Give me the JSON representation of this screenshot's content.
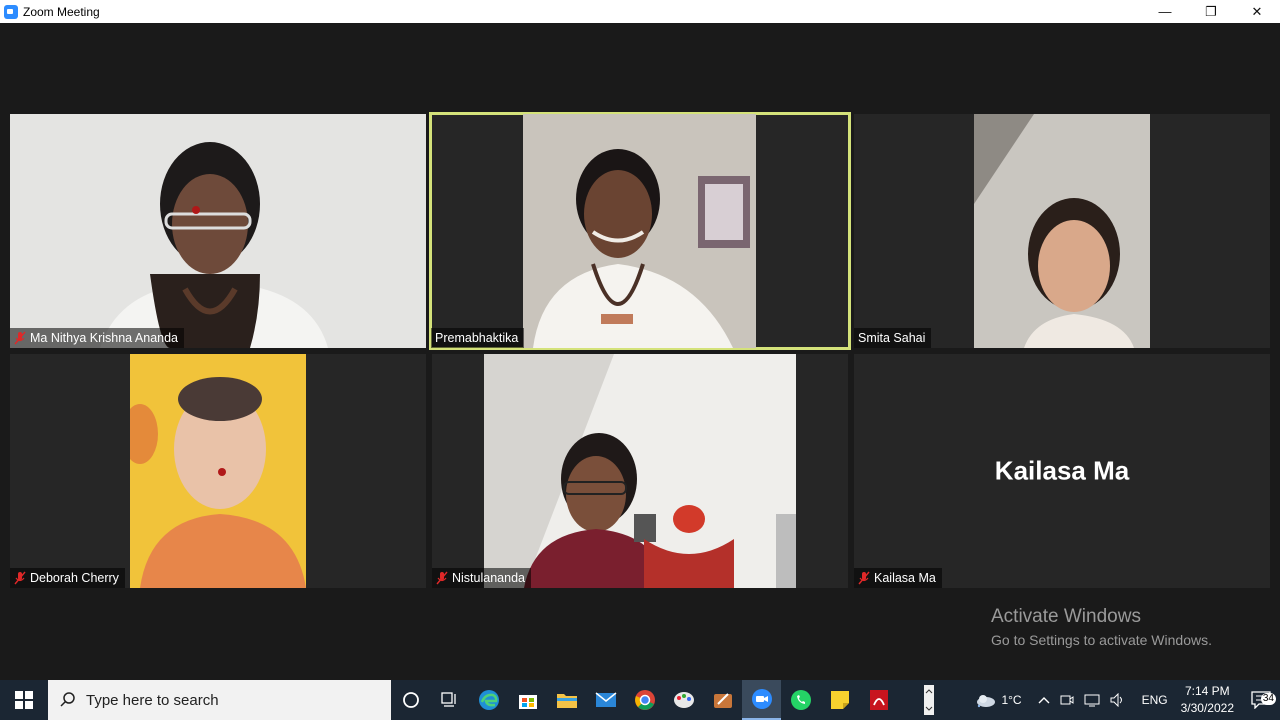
{
  "window": {
    "title": "Zoom Meeting",
    "minimize": "—",
    "restore": "❐",
    "close": "✕"
  },
  "participants": [
    {
      "name": "Ma Nithya Krishna Ananda",
      "muted": true,
      "video": true,
      "active_speaker": false
    },
    {
      "name": "Premabhaktika",
      "muted": false,
      "video": true,
      "active_speaker": true
    },
    {
      "name": "Smita Sahai",
      "muted": false,
      "video": true,
      "active_speaker": false
    },
    {
      "name": "Deborah Cherry",
      "muted": true,
      "video": true,
      "active_speaker": false
    },
    {
      "name": "Nistulananda",
      "muted": true,
      "video": true,
      "active_speaker": false
    },
    {
      "name": "Kailasa Ma",
      "muted": true,
      "video": false,
      "active_speaker": false,
      "display_name_large": "Kailasa Ma"
    }
  ],
  "watermark": {
    "line1": "Activate Windows",
    "line2": "Go to Settings to activate Windows."
  },
  "taskbar": {
    "search_placeholder": "Type here to search",
    "apps": [
      "cortana-icon",
      "task-view-icon",
      "edge-icon",
      "store-icon",
      "file-explorer-icon",
      "mail-icon",
      "chrome-icon",
      "paint-icon",
      "sketch-app-icon",
      "zoom-icon",
      "whatsapp-icon",
      "sticky-notes-icon",
      "acrobat-icon"
    ],
    "weather_temp": "1°C",
    "language": "ENG",
    "time": "7:14 PM",
    "date": "3/30/2022",
    "notification_count": "34"
  },
  "colors": {
    "active_speaker_border": "#d4e27a",
    "mute_icon": "#e02828",
    "zoom_blue": "#2d8cff"
  }
}
